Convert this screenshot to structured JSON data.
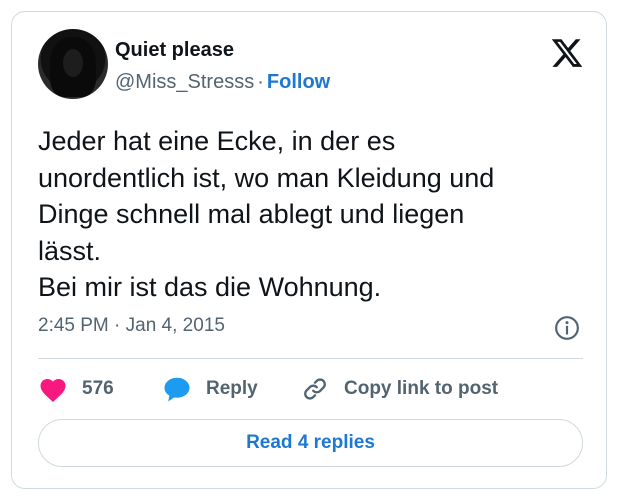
{
  "author": {
    "display_name": "Quiet please",
    "handle": "@Miss_Stresss",
    "separator": "·",
    "follow_label": "Follow"
  },
  "tweet": {
    "text": "Jeder hat eine Ecke, in der es\nunordentlich ist, wo man Kleidung und\nDinge schnell mal ablegt und liegen\nlässt.\nBei mir ist das die Wohnung.",
    "timestamp": "2:45 PM · Jan 4, 2015"
  },
  "actions": {
    "like_count": "576",
    "reply_label": "Reply",
    "copy_label": "Copy link to post"
  },
  "read_replies_label": "Read 4 replies",
  "colors": {
    "accent": "#1d78d1",
    "like": "#f91880",
    "reply_icon": "#1d9bf0",
    "muted": "#536471",
    "border": "#cfd9de"
  },
  "icons": [
    "x-logo-icon",
    "info-icon",
    "heart-icon",
    "reply-bubble-icon",
    "link-icon"
  ]
}
